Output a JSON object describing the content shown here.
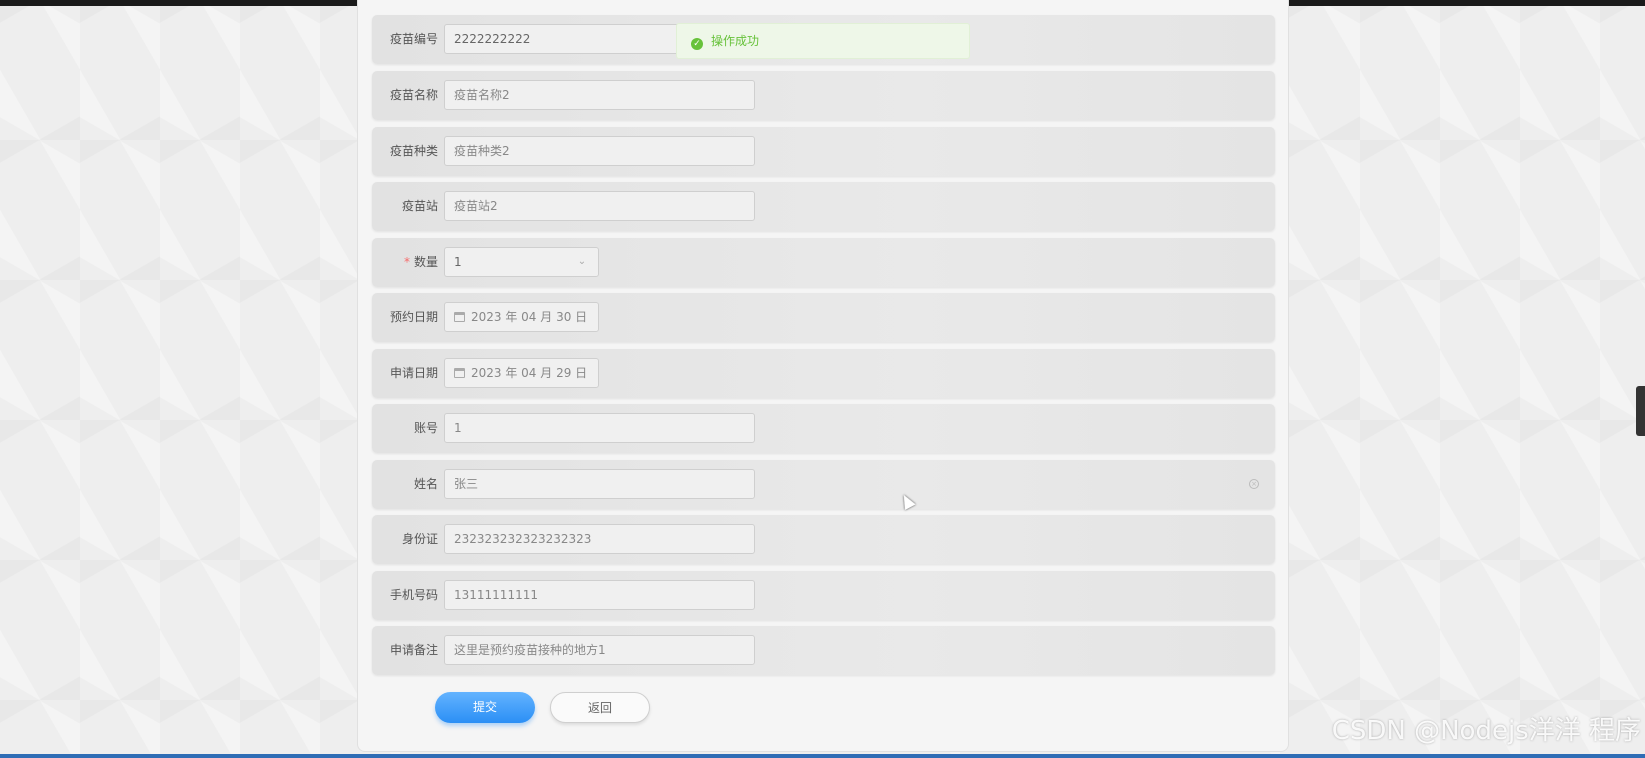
{
  "form": {
    "rows": [
      {
        "label": "疫苗编号",
        "value": "2222222222"
      },
      {
        "label": "疫苗名称",
        "value": "疫苗名称2"
      },
      {
        "label": "疫苗种类",
        "value": "疫苗种类2"
      },
      {
        "label": "疫苗站",
        "value": "疫苗站2"
      },
      {
        "label": "数量",
        "value": "1",
        "required_mark": "*"
      },
      {
        "label": "预约日期",
        "value": "2023 年 04 月 30 日"
      },
      {
        "label": "申请日期",
        "value": "2023 年 04 月 29 日"
      },
      {
        "label": "账号",
        "value": "1"
      },
      {
        "label": "姓名",
        "value": "张三"
      },
      {
        "label": "身份证",
        "value": "232323232323232323"
      },
      {
        "label": "手机号码",
        "value": "13111111111"
      },
      {
        "label": "申请备注",
        "value": "这里是预约疫苗接种的地方1"
      }
    ]
  },
  "toast": {
    "message": "操作成功",
    "icon": "check-circle-icon",
    "color": "#67c23a"
  },
  "buttons": {
    "submit_label": "提交",
    "back_label": "返回"
  },
  "watermark": {
    "text": "CSDN @Nodejs洋洋  程序"
  },
  "colors": {
    "primary": "#2b8ff5",
    "success": "#67c23a",
    "required": "#f56c6c"
  }
}
